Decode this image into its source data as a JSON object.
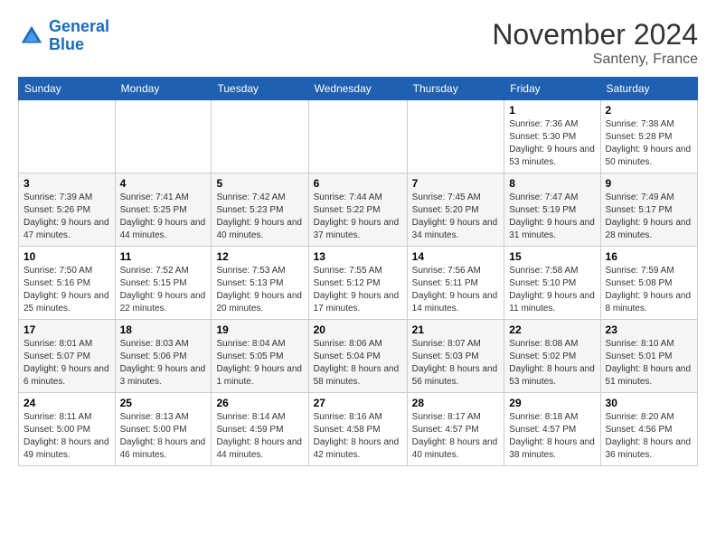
{
  "logo": {
    "line1": "General",
    "line2": "Blue"
  },
  "title": "November 2024",
  "subtitle": "Santeny, France",
  "days_of_week": [
    "Sunday",
    "Monday",
    "Tuesday",
    "Wednesday",
    "Thursday",
    "Friday",
    "Saturday"
  ],
  "weeks": [
    [
      {
        "day": "",
        "info": ""
      },
      {
        "day": "",
        "info": ""
      },
      {
        "day": "",
        "info": ""
      },
      {
        "day": "",
        "info": ""
      },
      {
        "day": "",
        "info": ""
      },
      {
        "day": "1",
        "info": "Sunrise: 7:36 AM\nSunset: 5:30 PM\nDaylight: 9 hours and 53 minutes."
      },
      {
        "day": "2",
        "info": "Sunrise: 7:38 AM\nSunset: 5:28 PM\nDaylight: 9 hours and 50 minutes."
      }
    ],
    [
      {
        "day": "3",
        "info": "Sunrise: 7:39 AM\nSunset: 5:26 PM\nDaylight: 9 hours and 47 minutes."
      },
      {
        "day": "4",
        "info": "Sunrise: 7:41 AM\nSunset: 5:25 PM\nDaylight: 9 hours and 44 minutes."
      },
      {
        "day": "5",
        "info": "Sunrise: 7:42 AM\nSunset: 5:23 PM\nDaylight: 9 hours and 40 minutes."
      },
      {
        "day": "6",
        "info": "Sunrise: 7:44 AM\nSunset: 5:22 PM\nDaylight: 9 hours and 37 minutes."
      },
      {
        "day": "7",
        "info": "Sunrise: 7:45 AM\nSunset: 5:20 PM\nDaylight: 9 hours and 34 minutes."
      },
      {
        "day": "8",
        "info": "Sunrise: 7:47 AM\nSunset: 5:19 PM\nDaylight: 9 hours and 31 minutes."
      },
      {
        "day": "9",
        "info": "Sunrise: 7:49 AM\nSunset: 5:17 PM\nDaylight: 9 hours and 28 minutes."
      }
    ],
    [
      {
        "day": "10",
        "info": "Sunrise: 7:50 AM\nSunset: 5:16 PM\nDaylight: 9 hours and 25 minutes."
      },
      {
        "day": "11",
        "info": "Sunrise: 7:52 AM\nSunset: 5:15 PM\nDaylight: 9 hours and 22 minutes."
      },
      {
        "day": "12",
        "info": "Sunrise: 7:53 AM\nSunset: 5:13 PM\nDaylight: 9 hours and 20 minutes."
      },
      {
        "day": "13",
        "info": "Sunrise: 7:55 AM\nSunset: 5:12 PM\nDaylight: 9 hours and 17 minutes."
      },
      {
        "day": "14",
        "info": "Sunrise: 7:56 AM\nSunset: 5:11 PM\nDaylight: 9 hours and 14 minutes."
      },
      {
        "day": "15",
        "info": "Sunrise: 7:58 AM\nSunset: 5:10 PM\nDaylight: 9 hours and 11 minutes."
      },
      {
        "day": "16",
        "info": "Sunrise: 7:59 AM\nSunset: 5:08 PM\nDaylight: 9 hours and 8 minutes."
      }
    ],
    [
      {
        "day": "17",
        "info": "Sunrise: 8:01 AM\nSunset: 5:07 PM\nDaylight: 9 hours and 6 minutes."
      },
      {
        "day": "18",
        "info": "Sunrise: 8:03 AM\nSunset: 5:06 PM\nDaylight: 9 hours and 3 minutes."
      },
      {
        "day": "19",
        "info": "Sunrise: 8:04 AM\nSunset: 5:05 PM\nDaylight: 9 hours and 1 minute."
      },
      {
        "day": "20",
        "info": "Sunrise: 8:06 AM\nSunset: 5:04 PM\nDaylight: 8 hours and 58 minutes."
      },
      {
        "day": "21",
        "info": "Sunrise: 8:07 AM\nSunset: 5:03 PM\nDaylight: 8 hours and 56 minutes."
      },
      {
        "day": "22",
        "info": "Sunrise: 8:08 AM\nSunset: 5:02 PM\nDaylight: 8 hours and 53 minutes."
      },
      {
        "day": "23",
        "info": "Sunrise: 8:10 AM\nSunset: 5:01 PM\nDaylight: 8 hours and 51 minutes."
      }
    ],
    [
      {
        "day": "24",
        "info": "Sunrise: 8:11 AM\nSunset: 5:00 PM\nDaylight: 8 hours and 49 minutes."
      },
      {
        "day": "25",
        "info": "Sunrise: 8:13 AM\nSunset: 5:00 PM\nDaylight: 8 hours and 46 minutes."
      },
      {
        "day": "26",
        "info": "Sunrise: 8:14 AM\nSunset: 4:59 PM\nDaylight: 8 hours and 44 minutes."
      },
      {
        "day": "27",
        "info": "Sunrise: 8:16 AM\nSunset: 4:58 PM\nDaylight: 8 hours and 42 minutes."
      },
      {
        "day": "28",
        "info": "Sunrise: 8:17 AM\nSunset: 4:57 PM\nDaylight: 8 hours and 40 minutes."
      },
      {
        "day": "29",
        "info": "Sunrise: 8:18 AM\nSunset: 4:57 PM\nDaylight: 8 hours and 38 minutes."
      },
      {
        "day": "30",
        "info": "Sunrise: 8:20 AM\nSunset: 4:56 PM\nDaylight: 8 hours and 36 minutes."
      }
    ]
  ]
}
